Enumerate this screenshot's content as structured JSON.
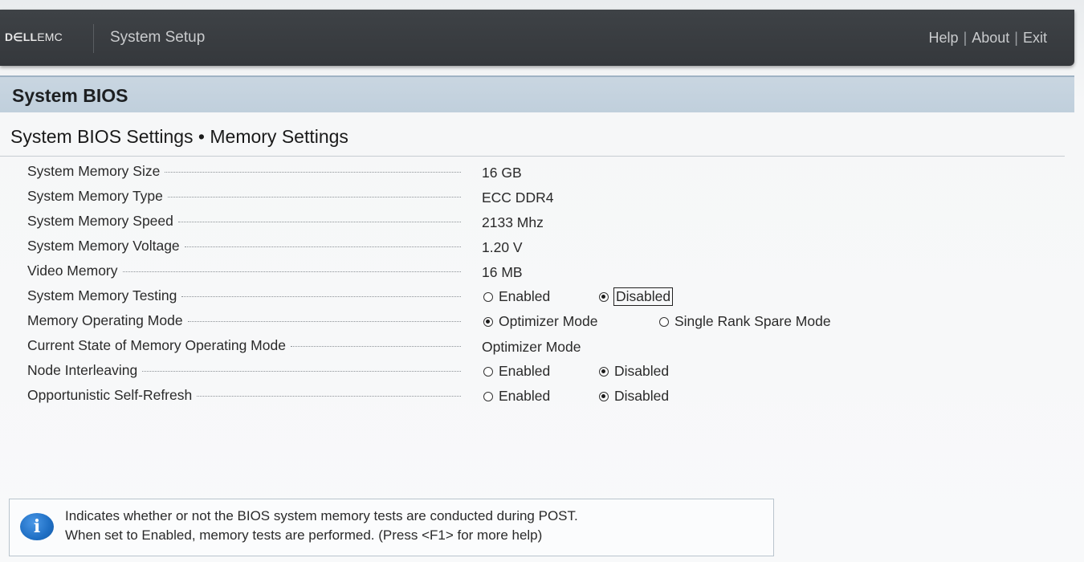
{
  "header": {
    "brand_dell": "D∈LL",
    "brand_emc": "EMC",
    "app_title": "System Setup",
    "links": [
      "Help",
      "About",
      "Exit"
    ],
    "separator": "|"
  },
  "section": {
    "title": "System BIOS",
    "breadcrumb": "System BIOS Settings • Memory Settings"
  },
  "settings": [
    {
      "label": "System Memory Size",
      "value": "16 GB"
    },
    {
      "label": "System Memory Type",
      "value": "ECC DDR4"
    },
    {
      "label": "System Memory Speed",
      "value": "2133 Mhz"
    },
    {
      "label": "System Memory Voltage",
      "value": "1.20 V"
    },
    {
      "label": "Video Memory",
      "value": "16 MB"
    },
    {
      "label": "System Memory Testing",
      "options": [
        "Enabled",
        "Disabled"
      ],
      "selected": "Disabled"
    },
    {
      "label": "Memory Operating Mode",
      "options": [
        "Optimizer Mode",
        "Single Rank Spare Mode"
      ],
      "selected": "Optimizer Mode"
    },
    {
      "label": "Current State of Memory Operating Mode",
      "value": "Optimizer Mode"
    },
    {
      "label": "Node Interleaving",
      "options": [
        "Enabled",
        "Disabled"
      ],
      "selected": "Disabled"
    },
    {
      "label": "Opportunistic Self-Refresh",
      "options": [
        "Enabled",
        "Disabled"
      ],
      "selected": "Disabled"
    }
  ],
  "help": {
    "icon": "info-icon",
    "icon_glyph": "i",
    "line1": "Indicates whether or not the BIOS system memory tests are conducted during POST.",
    "line2": "When set to Enabled, memory tests are performed. (Press <F1> for more help)"
  }
}
